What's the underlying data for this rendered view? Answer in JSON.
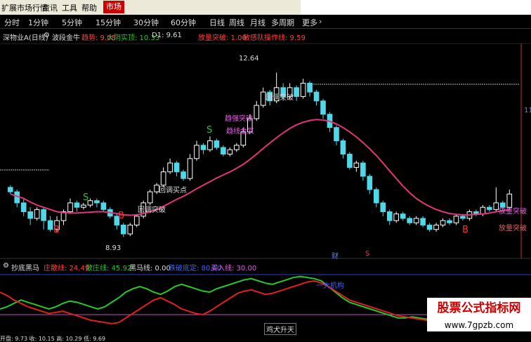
{
  "menu": {
    "items": [
      "扩展市场行情",
      "资讯",
      "工具",
      "帮助"
    ],
    "active": "市场"
  },
  "periods": {
    "items": [
      "分时",
      "1分钟",
      "5分钟",
      "15分钟",
      "30分钟",
      "60分钟",
      "日线",
      "周线",
      "月线",
      "多周期",
      "更多"
    ],
    "more_icon": "chevron-right-icon"
  },
  "legend": {
    "stock": "深物业A(日线)",
    "indicator": "波段金牛",
    "trend": "趋势: 9.08",
    "big_yang": "大阴实顶: 10.33",
    "d1": "D1: 9.61",
    "volume_break": "放量突破: 1.00",
    "sensitive": "敏感队操作线: 9.59"
  },
  "labels": {
    "high": "12.64",
    "low": "8.93",
    "callback1": "回调买点",
    "callback2": "回调突破",
    "callback3": "回调突破",
    "break_strong": "趋强突破",
    "trend_line": "趋线金叉",
    "volume_right1": "放量突破",
    "volume_right2": "放量突破",
    "b": "B",
    "s": "S",
    "cai": "财",
    "s_red": "S",
    "right_price": "11"
  },
  "indicator": {
    "name": "抄底黑马",
    "li": "庄散线: 24.49",
    "san": "散庄线: 45.92",
    "heima": "黑马线: 0.00",
    "cutoff": "跌破底定: 80.00",
    "buy": "买入线: 30.00",
    "jigou": "一大机构",
    "jiquan": "鸡犬升天"
  },
  "watermark": {
    "title": "股票公式指标网",
    "url": "www.7gpzb.com"
  },
  "status": "开盘: 9.73  收: 10.15  高: 10.29  低: 9.69",
  "colors": {
    "up": "#ffffff",
    "down": "#4fd8e8",
    "ma": "#e0357a",
    "green_line": "#28c828",
    "red_line": "#e02020",
    "blue_line": "#2050e0"
  },
  "chart_data": {
    "type": "candlestick",
    "candles": [
      {
        "o": 10.05,
        "c": 9.95,
        "h": 10.1,
        "l": 9.9
      },
      {
        "o": 9.95,
        "c": 9.7,
        "h": 10.0,
        "l": 9.6
      },
      {
        "o": 9.7,
        "c": 9.5,
        "h": 9.8,
        "l": 9.4
      },
      {
        "o": 9.5,
        "c": 9.35,
        "h": 9.6,
        "l": 9.2
      },
      {
        "o": 9.35,
        "c": 9.55,
        "h": 9.6,
        "l": 9.3
      },
      {
        "o": 9.55,
        "c": 9.3,
        "h": 9.6,
        "l": 9.1
      },
      {
        "o": 9.3,
        "c": 9.1,
        "h": 9.4,
        "l": 9.05
      },
      {
        "o": 9.1,
        "c": 9.3,
        "h": 9.4,
        "l": 9.05
      },
      {
        "o": 9.3,
        "c": 9.5,
        "h": 9.55,
        "l": 9.2
      },
      {
        "o": 9.5,
        "c": 9.7,
        "h": 9.8,
        "l": 9.45
      },
      {
        "o": 9.7,
        "c": 9.6,
        "h": 9.75,
        "l": 9.5
      },
      {
        "o": 9.6,
        "c": 9.65,
        "h": 9.7,
        "l": 9.55
      },
      {
        "o": 9.65,
        "c": 9.75,
        "h": 9.8,
        "l": 9.6
      },
      {
        "o": 9.75,
        "c": 9.7,
        "h": 9.8,
        "l": 9.6
      },
      {
        "o": 9.7,
        "c": 9.55,
        "h": 9.75,
        "l": 9.5
      },
      {
        "o": 9.55,
        "c": 9.4,
        "h": 9.6,
        "l": 9.35
      },
      {
        "o": 9.4,
        "c": 9.2,
        "h": 9.45,
        "l": 9.1
      },
      {
        "o": 9.2,
        "c": 9.0,
        "h": 9.25,
        "l": 8.93
      },
      {
        "o": 9.0,
        "c": 9.2,
        "h": 9.25,
        "l": 8.95
      },
      {
        "o": 9.2,
        "c": 9.4,
        "h": 9.45,
        "l": 9.15
      },
      {
        "o": 9.4,
        "c": 9.7,
        "h": 9.75,
        "l": 9.35
      },
      {
        "o": 9.7,
        "c": 9.95,
        "h": 10.0,
        "l": 9.65
      },
      {
        "o": 9.95,
        "c": 10.1,
        "h": 10.15,
        "l": 9.9
      },
      {
        "o": 10.1,
        "c": 10.4,
        "h": 10.5,
        "l": 10.05
      },
      {
        "o": 10.4,
        "c": 10.6,
        "h": 10.7,
        "l": 10.35
      },
      {
        "o": 10.6,
        "c": 10.4,
        "h": 10.65,
        "l": 10.3
      },
      {
        "o": 10.4,
        "c": 10.25,
        "h": 10.45,
        "l": 10.2
      },
      {
        "o": 10.25,
        "c": 10.7,
        "h": 10.8,
        "l": 10.2
      },
      {
        "o": 10.7,
        "c": 11.0,
        "h": 11.1,
        "l": 10.65
      },
      {
        "o": 11.0,
        "c": 10.9,
        "h": 11.05,
        "l": 10.8
      },
      {
        "o": 10.9,
        "c": 11.1,
        "h": 11.2,
        "l": 10.85
      },
      {
        "o": 11.1,
        "c": 10.95,
        "h": 11.15,
        "l": 10.9
      },
      {
        "o": 10.95,
        "c": 10.8,
        "h": 11.0,
        "l": 10.75
      },
      {
        "o": 10.8,
        "c": 10.9,
        "h": 10.95,
        "l": 10.75
      },
      {
        "o": 10.9,
        "c": 11.0,
        "h": 11.05,
        "l": 10.85
      },
      {
        "o": 11.0,
        "c": 11.3,
        "h": 11.4,
        "l": 10.95
      },
      {
        "o": 11.3,
        "c": 11.6,
        "h": 11.7,
        "l": 11.25
      },
      {
        "o": 11.6,
        "c": 11.9,
        "h": 12.0,
        "l": 11.55
      },
      {
        "o": 11.9,
        "c": 12.2,
        "h": 12.3,
        "l": 11.85
      },
      {
        "o": 12.2,
        "c": 12.0,
        "h": 12.25,
        "l": 11.9
      },
      {
        "o": 12.0,
        "c": 12.3,
        "h": 12.64,
        "l": 11.95
      },
      {
        "o": 12.3,
        "c": 12.1,
        "h": 12.4,
        "l": 12.0
      },
      {
        "o": 12.1,
        "c": 12.3,
        "h": 12.4,
        "l": 12.05
      },
      {
        "o": 12.3,
        "c": 12.1,
        "h": 12.35,
        "l": 12.0
      },
      {
        "o": 12.1,
        "c": 12.4,
        "h": 12.5,
        "l": 12.05
      },
      {
        "o": 12.4,
        "c": 12.2,
        "h": 12.45,
        "l": 12.1
      },
      {
        "o": 12.2,
        "c": 12.0,
        "h": 12.25,
        "l": 11.9
      },
      {
        "o": 12.0,
        "c": 11.7,
        "h": 12.05,
        "l": 11.6
      },
      {
        "o": 11.7,
        "c": 11.4,
        "h": 11.75,
        "l": 11.3
      },
      {
        "o": 11.4,
        "c": 11.1,
        "h": 11.45,
        "l": 11.0
      },
      {
        "o": 11.1,
        "c": 10.8,
        "h": 11.15,
        "l": 10.7
      },
      {
        "o": 10.8,
        "c": 10.5,
        "h": 10.85,
        "l": 10.45
      },
      {
        "o": 10.5,
        "c": 10.6,
        "h": 10.65,
        "l": 10.4
      },
      {
        "o": 10.6,
        "c": 10.3,
        "h": 10.65,
        "l": 10.2
      },
      {
        "o": 10.3,
        "c": 10.0,
        "h": 10.35,
        "l": 9.9
      },
      {
        "o": 10.0,
        "c": 9.7,
        "h": 10.05,
        "l": 9.6
      },
      {
        "o": 9.7,
        "c": 9.5,
        "h": 9.75,
        "l": 9.4
      },
      {
        "o": 9.5,
        "c": 9.3,
        "h": 9.55,
        "l": 9.2
      },
      {
        "o": 9.3,
        "c": 9.45,
        "h": 9.5,
        "l": 9.25
      },
      {
        "o": 9.45,
        "c": 9.35,
        "h": 9.5,
        "l": 9.3
      },
      {
        "o": 9.35,
        "c": 9.25,
        "h": 9.4,
        "l": 9.2
      },
      {
        "o": 9.25,
        "c": 9.35,
        "h": 9.4,
        "l": 9.2
      },
      {
        "o": 9.35,
        "c": 9.2,
        "h": 9.4,
        "l": 9.15
      },
      {
        "o": 9.2,
        "c": 9.1,
        "h": 9.25,
        "l": 9.05
      },
      {
        "o": 9.1,
        "c": 9.2,
        "h": 9.25,
        "l": 9.05
      },
      {
        "o": 9.2,
        "c": 9.3,
        "h": 9.35,
        "l": 9.15
      },
      {
        "o": 9.3,
        "c": 9.25,
        "h": 9.35,
        "l": 9.2
      },
      {
        "o": 9.25,
        "c": 9.4,
        "h": 9.45,
        "l": 9.2
      },
      {
        "o": 9.4,
        "c": 9.35,
        "h": 9.45,
        "l": 9.3
      },
      {
        "o": 9.35,
        "c": 9.5,
        "h": 9.55,
        "l": 9.3
      },
      {
        "o": 9.5,
        "c": 9.45,
        "h": 9.55,
        "l": 9.4
      },
      {
        "o": 9.45,
        "c": 9.6,
        "h": 9.65,
        "l": 9.4
      },
      {
        "o": 9.6,
        "c": 9.55,
        "h": 9.65,
        "l": 9.5
      },
      {
        "o": 9.55,
        "c": 9.7,
        "h": 10.05,
        "l": 9.5
      },
      {
        "o": 9.7,
        "c": 9.6,
        "h": 9.75,
        "l": 9.55
      },
      {
        "o": 9.6,
        "c": 9.9,
        "h": 10.0,
        "l": 9.55
      }
    ],
    "ma": [
      9.9,
      9.85,
      9.8,
      9.72,
      9.65,
      9.6,
      9.55,
      9.5,
      9.48,
      9.47,
      9.47,
      9.48,
      9.49,
      9.5,
      9.5,
      9.48,
      9.46,
      9.43,
      9.42,
      9.43,
      9.46,
      9.5,
      9.55,
      9.62,
      9.7,
      9.78,
      9.85,
      9.93,
      10.02,
      10.1,
      10.18,
      10.26,
      10.33,
      10.4,
      10.48,
      10.57,
      10.68,
      10.8,
      10.93,
      11.05,
      11.17,
      11.28,
      11.38,
      11.46,
      11.52,
      11.56,
      11.58,
      11.57,
      11.54,
      11.48,
      11.4,
      11.3,
      11.19,
      11.06,
      10.92,
      10.77,
      10.6,
      10.42,
      10.25,
      10.08,
      9.93,
      9.8,
      9.7,
      9.62,
      9.55,
      9.5,
      9.46,
      9.44,
      9.43,
      9.43,
      9.44,
      9.45,
      9.47,
      9.5,
      9.52,
      9.55
    ],
    "ylim": [
      8.7,
      13.2
    ],
    "indicator_lines": {
      "green": [
        20,
        22,
        25,
        28,
        26,
        24,
        22,
        20,
        22,
        25,
        27,
        26,
        24,
        22,
        20,
        22,
        26,
        30,
        35,
        38,
        40,
        38,
        35,
        33,
        36,
        40,
        42,
        40,
        38,
        36,
        35,
        38,
        40,
        42,
        44,
        46,
        47,
        45,
        43,
        42,
        44,
        46,
        48,
        49,
        48,
        47,
        45,
        40,
        35,
        30,
        26,
        24,
        22,
        20,
        18,
        16,
        14,
        12,
        12,
        13,
        12,
        11,
        10,
        9,
        8,
        8,
        9,
        10,
        9,
        8,
        8,
        9,
        10,
        10,
        9,
        10
      ],
      "red": [
        35,
        32,
        28,
        25,
        22,
        20,
        18,
        16,
        17,
        18,
        16,
        14,
        12,
        10,
        9,
        8,
        7,
        8,
        12,
        16,
        20,
        24,
        28,
        30,
        27,
        24,
        20,
        18,
        16,
        15,
        18,
        22,
        26,
        30,
        34,
        36,
        37,
        35,
        33,
        34,
        36,
        38,
        40,
        42,
        44,
        45,
        43,
        40,
        36,
        32,
        28,
        26,
        24,
        22,
        20,
        18,
        16,
        14,
        13,
        12,
        11,
        10,
        10,
        9,
        9,
        8,
        9,
        10,
        11,
        12,
        11,
        10,
        9,
        10,
        11,
        12
      ]
    }
  }
}
